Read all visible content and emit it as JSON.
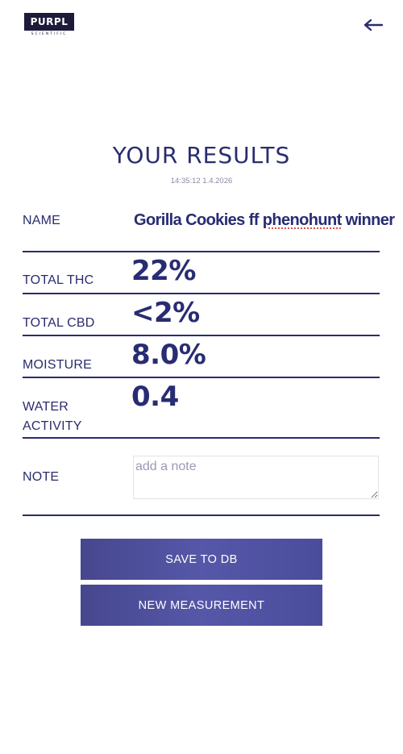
{
  "header": {
    "logo_text": "PURPL",
    "logo_subtext": "SCIENTIFIC",
    "back_icon": "arrow-left-icon"
  },
  "title": "YOUR RESULTS",
  "timestamp": "14:35:12 1.4.2026",
  "name": {
    "label": "NAME",
    "value_part1": "Gorilla Cookies ff ",
    "value_spell": "phenohunt",
    "value_part2": " winner"
  },
  "results": [
    {
      "label": "TOTAL THC",
      "value": "22%"
    },
    {
      "label": "TOTAL CBD",
      "value": "<2%"
    },
    {
      "label": "MOISTURE",
      "value": "8.0%"
    },
    {
      "label_line1": "WATER",
      "label_line2": "ACTIVITY",
      "value": "0.4"
    }
  ],
  "note": {
    "label": "NOTE",
    "placeholder": "add a note",
    "value": ""
  },
  "buttons": {
    "save": "SAVE TO DB",
    "new_measurement": "NEW MEASUREMENT"
  },
  "colors": {
    "primary": "#2a2c6e",
    "button": "#5052a0",
    "timestamp": "#8a8aa6"
  }
}
